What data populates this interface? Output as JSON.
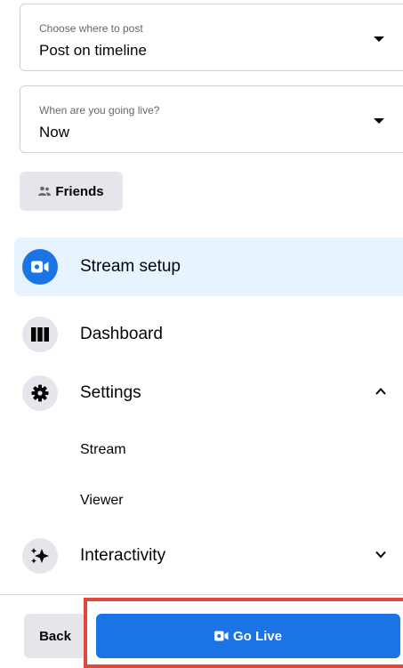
{
  "post_location": {
    "label": "Choose where to post",
    "value": "Post on timeline",
    "caret_icon": "caret-down-icon"
  },
  "schedule": {
    "label": "When are you going live?",
    "value": "Now",
    "caret_icon": "caret-down-icon"
  },
  "audience": {
    "label": "Friends",
    "icon": "friends-icon"
  },
  "nav": {
    "stream_setup": {
      "label": "Stream setup",
      "icon": "video-camera-icon"
    },
    "dashboard": {
      "label": "Dashboard",
      "icon": "dashboard-columns-icon"
    },
    "settings": {
      "label": "Settings",
      "icon": "gear-icon",
      "expanded": true,
      "sub_items": {
        "stream": "Stream",
        "viewer": "Viewer"
      }
    },
    "interactivity": {
      "label": "Interactivity",
      "icon": "sparkle-icon",
      "expanded": false
    }
  },
  "footer": {
    "back_label": "Back",
    "go_live_label": "Go Live",
    "go_live_icon": "video-camera-icon"
  },
  "colors": {
    "primary_blue": "#1b74e4",
    "active_bg": "#e7f3ff",
    "button_gray": "#e4e6eb",
    "highlight_red": "#e0483d"
  }
}
